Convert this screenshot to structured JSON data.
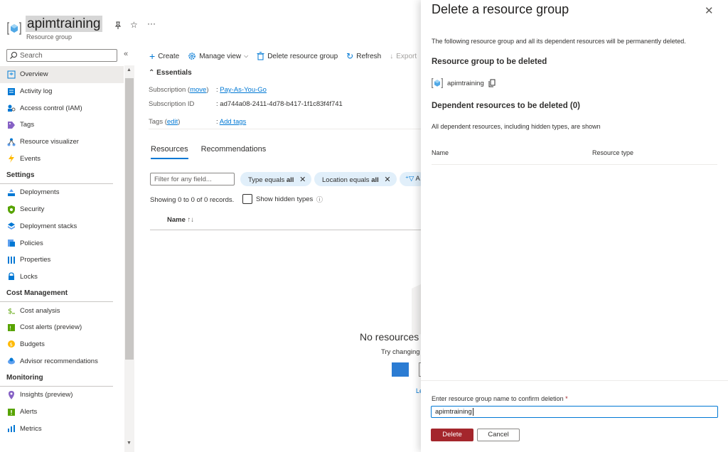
{
  "header": {
    "title": "apimtraining",
    "subtitle": "Resource group",
    "more": "···"
  },
  "sidebar": {
    "search_placeholder": "Search",
    "collapse": "«",
    "items_top": [
      {
        "label": "Overview",
        "icon": "overview-icon"
      },
      {
        "label": "Activity log",
        "icon": "activity-log-icon"
      },
      {
        "label": "Access control (IAM)",
        "icon": "iam-icon"
      },
      {
        "label": "Tags",
        "icon": "tag-icon"
      },
      {
        "label": "Resource visualizer",
        "icon": "visualizer-icon"
      },
      {
        "label": "Events",
        "icon": "lightning-icon"
      }
    ],
    "group_settings": "Settings",
    "items_settings": [
      {
        "label": "Deployments",
        "icon": "deployments-icon"
      },
      {
        "label": "Security",
        "icon": "shield-icon"
      },
      {
        "label": "Deployment stacks",
        "icon": "stacks-icon"
      },
      {
        "label": "Policies",
        "icon": "policy-icon"
      },
      {
        "label": "Properties",
        "icon": "properties-icon"
      },
      {
        "label": "Locks",
        "icon": "lock-icon"
      }
    ],
    "group_cost": "Cost Management",
    "items_cost": [
      {
        "label": "Cost analysis",
        "icon": "cost-icon"
      },
      {
        "label": "Cost alerts (preview)",
        "icon": "cost-alert-icon"
      },
      {
        "label": "Budgets",
        "icon": "budget-icon"
      },
      {
        "label": "Advisor recommendations",
        "icon": "advisor-icon"
      }
    ],
    "group_monitoring": "Monitoring",
    "items_monitoring": [
      {
        "label": "Insights (preview)",
        "icon": "insights-icon"
      },
      {
        "label": "Alerts",
        "icon": "alerts-icon"
      },
      {
        "label": "Metrics",
        "icon": "metrics-icon"
      }
    ]
  },
  "toolbar": {
    "create": "Create",
    "manage_view": "Manage view",
    "delete_rg": "Delete resource group",
    "refresh": "Refresh",
    "export": "Export"
  },
  "essentials": {
    "title": "Essentials",
    "subscription_label": "Subscription",
    "move": "move",
    "subscription_value": "Pay-As-You-Go",
    "subscription_id_label": "Subscription ID",
    "subscription_id_value": "ad744a08-2411-4d78-b417-1f1c83f4f741",
    "tags_label": "Tags",
    "edit": "edit",
    "add_tags": "Add tags"
  },
  "tabs": {
    "resources": "Resources",
    "recommendations": "Recommendations"
  },
  "filters": {
    "placeholder": "Filter for any field...",
    "type_label": "Type equals",
    "type_value": "all",
    "location_label": "Location equals",
    "location_value": "all",
    "add": "A"
  },
  "records": {
    "showing": "Showing 0 to 0 of 0 records.",
    "show_hidden": "Show hidden types",
    "col_name": "Name"
  },
  "empty": {
    "title": "No resources",
    "hint": "Try changing",
    "learn": "Le"
  },
  "panel": {
    "title": "Delete a resource group",
    "description": "The following resource group and all its dependent resources will be permanently deleted.",
    "rg_heading": "Resource group to be deleted",
    "rg_name": "apimtraining",
    "dependent_heading": "Dependent resources to be deleted (0)",
    "dependent_note": "All dependent resources, including hidden types, are shown",
    "col_name": "Name",
    "col_type": "Resource type",
    "confirm_label": "Enter resource group name to confirm deletion",
    "required_mark": "*",
    "confirm_value": "apimtraining",
    "delete_label": "Delete",
    "cancel_label": "Cancel"
  },
  "colors": {
    "accent": "#0078d4",
    "danger": "#a4262c",
    "pill_bg": "#e1effa"
  }
}
